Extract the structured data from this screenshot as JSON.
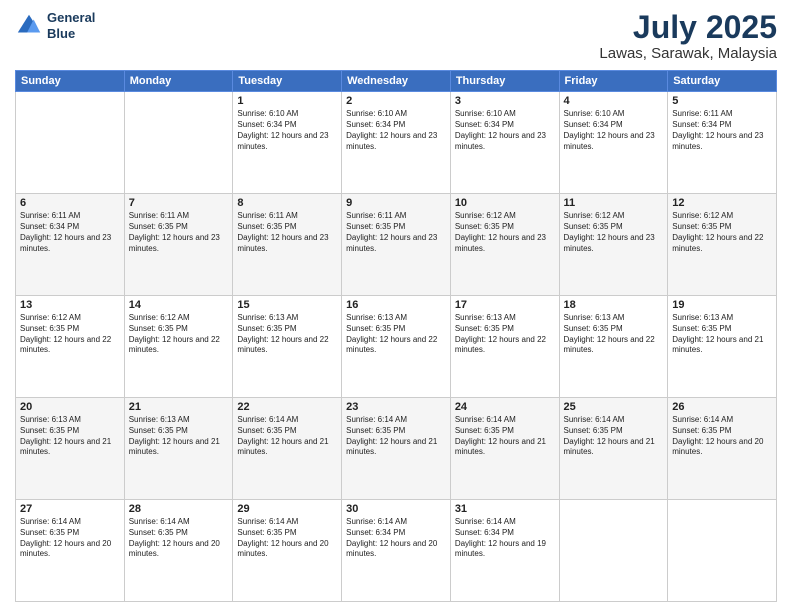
{
  "header": {
    "logo_line1": "General",
    "logo_line2": "Blue",
    "month": "July 2025",
    "location": "Lawas, Sarawak, Malaysia"
  },
  "weekdays": [
    "Sunday",
    "Monday",
    "Tuesday",
    "Wednesday",
    "Thursday",
    "Friday",
    "Saturday"
  ],
  "weeks": [
    [
      {
        "day": "",
        "info": ""
      },
      {
        "day": "",
        "info": ""
      },
      {
        "day": "1",
        "info": "Sunrise: 6:10 AM\nSunset: 6:34 PM\nDaylight: 12 hours and 23 minutes."
      },
      {
        "day": "2",
        "info": "Sunrise: 6:10 AM\nSunset: 6:34 PM\nDaylight: 12 hours and 23 minutes."
      },
      {
        "day": "3",
        "info": "Sunrise: 6:10 AM\nSunset: 6:34 PM\nDaylight: 12 hours and 23 minutes."
      },
      {
        "day": "4",
        "info": "Sunrise: 6:10 AM\nSunset: 6:34 PM\nDaylight: 12 hours and 23 minutes."
      },
      {
        "day": "5",
        "info": "Sunrise: 6:11 AM\nSunset: 6:34 PM\nDaylight: 12 hours and 23 minutes."
      }
    ],
    [
      {
        "day": "6",
        "info": "Sunrise: 6:11 AM\nSunset: 6:34 PM\nDaylight: 12 hours and 23 minutes."
      },
      {
        "day": "7",
        "info": "Sunrise: 6:11 AM\nSunset: 6:35 PM\nDaylight: 12 hours and 23 minutes."
      },
      {
        "day": "8",
        "info": "Sunrise: 6:11 AM\nSunset: 6:35 PM\nDaylight: 12 hours and 23 minutes."
      },
      {
        "day": "9",
        "info": "Sunrise: 6:11 AM\nSunset: 6:35 PM\nDaylight: 12 hours and 23 minutes."
      },
      {
        "day": "10",
        "info": "Sunrise: 6:12 AM\nSunset: 6:35 PM\nDaylight: 12 hours and 23 minutes."
      },
      {
        "day": "11",
        "info": "Sunrise: 6:12 AM\nSunset: 6:35 PM\nDaylight: 12 hours and 23 minutes."
      },
      {
        "day": "12",
        "info": "Sunrise: 6:12 AM\nSunset: 6:35 PM\nDaylight: 12 hours and 22 minutes."
      }
    ],
    [
      {
        "day": "13",
        "info": "Sunrise: 6:12 AM\nSunset: 6:35 PM\nDaylight: 12 hours and 22 minutes."
      },
      {
        "day": "14",
        "info": "Sunrise: 6:12 AM\nSunset: 6:35 PM\nDaylight: 12 hours and 22 minutes."
      },
      {
        "day": "15",
        "info": "Sunrise: 6:13 AM\nSunset: 6:35 PM\nDaylight: 12 hours and 22 minutes."
      },
      {
        "day": "16",
        "info": "Sunrise: 6:13 AM\nSunset: 6:35 PM\nDaylight: 12 hours and 22 minutes."
      },
      {
        "day": "17",
        "info": "Sunrise: 6:13 AM\nSunset: 6:35 PM\nDaylight: 12 hours and 22 minutes."
      },
      {
        "day": "18",
        "info": "Sunrise: 6:13 AM\nSunset: 6:35 PM\nDaylight: 12 hours and 22 minutes."
      },
      {
        "day": "19",
        "info": "Sunrise: 6:13 AM\nSunset: 6:35 PM\nDaylight: 12 hours and 21 minutes."
      }
    ],
    [
      {
        "day": "20",
        "info": "Sunrise: 6:13 AM\nSunset: 6:35 PM\nDaylight: 12 hours and 21 minutes."
      },
      {
        "day": "21",
        "info": "Sunrise: 6:13 AM\nSunset: 6:35 PM\nDaylight: 12 hours and 21 minutes."
      },
      {
        "day": "22",
        "info": "Sunrise: 6:14 AM\nSunset: 6:35 PM\nDaylight: 12 hours and 21 minutes."
      },
      {
        "day": "23",
        "info": "Sunrise: 6:14 AM\nSunset: 6:35 PM\nDaylight: 12 hours and 21 minutes."
      },
      {
        "day": "24",
        "info": "Sunrise: 6:14 AM\nSunset: 6:35 PM\nDaylight: 12 hours and 21 minutes."
      },
      {
        "day": "25",
        "info": "Sunrise: 6:14 AM\nSunset: 6:35 PM\nDaylight: 12 hours and 21 minutes."
      },
      {
        "day": "26",
        "info": "Sunrise: 6:14 AM\nSunset: 6:35 PM\nDaylight: 12 hours and 20 minutes."
      }
    ],
    [
      {
        "day": "27",
        "info": "Sunrise: 6:14 AM\nSunset: 6:35 PM\nDaylight: 12 hours and 20 minutes."
      },
      {
        "day": "28",
        "info": "Sunrise: 6:14 AM\nSunset: 6:35 PM\nDaylight: 12 hours and 20 minutes."
      },
      {
        "day": "29",
        "info": "Sunrise: 6:14 AM\nSunset: 6:35 PM\nDaylight: 12 hours and 20 minutes."
      },
      {
        "day": "30",
        "info": "Sunrise: 6:14 AM\nSunset: 6:34 PM\nDaylight: 12 hours and 20 minutes."
      },
      {
        "day": "31",
        "info": "Sunrise: 6:14 AM\nSunset: 6:34 PM\nDaylight: 12 hours and 19 minutes."
      },
      {
        "day": "",
        "info": ""
      },
      {
        "day": "",
        "info": ""
      }
    ]
  ]
}
